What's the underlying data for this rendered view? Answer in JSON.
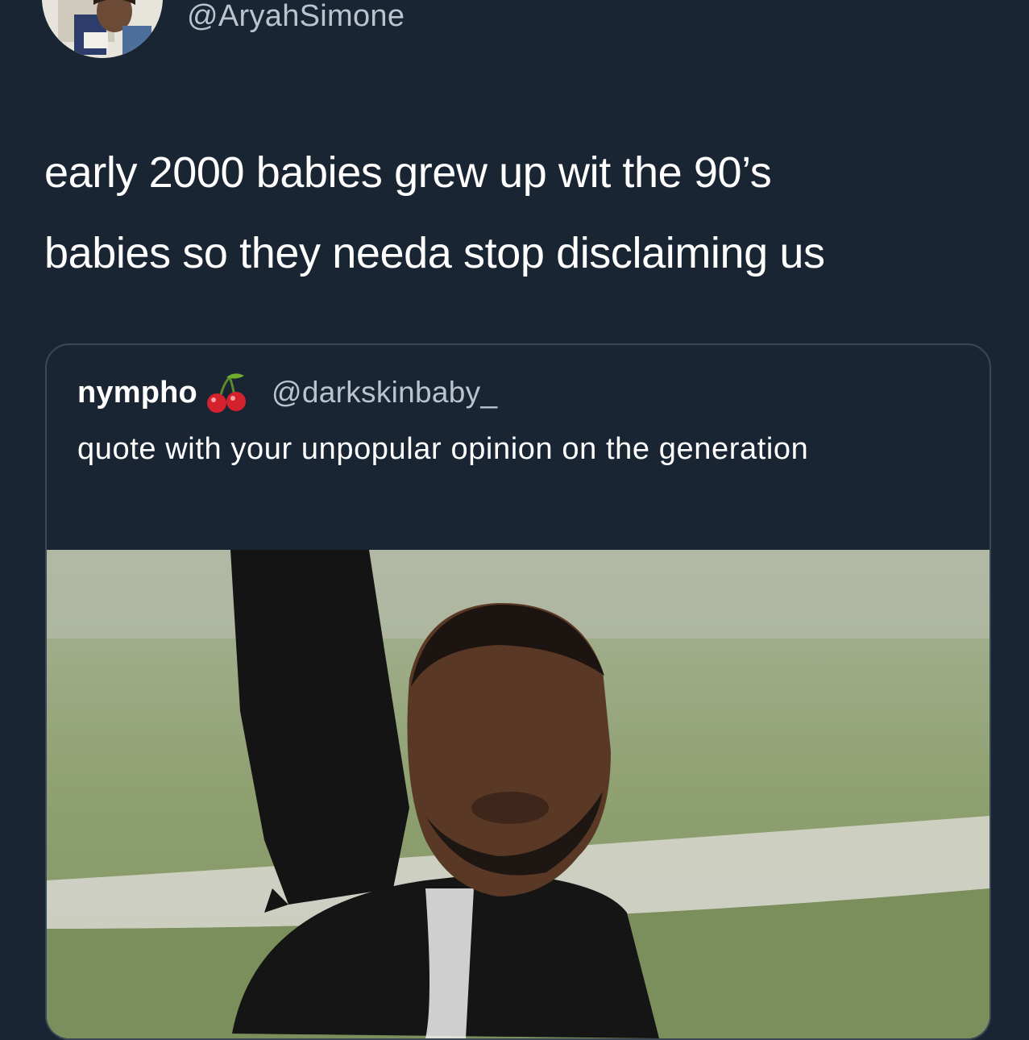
{
  "tweet": {
    "handle": "@AryahSimone",
    "text_line1": "early 2000 babies grew up wit the 90’s",
    "text_line2": "babies so they needa stop disclaiming us"
  },
  "quoted_tweet": {
    "display_name": "nympho",
    "name_emoji": "cherries-icon",
    "handle": "@darkskinbaby_",
    "text": "quote with your unpopular opinion on the generation"
  },
  "media": {
    "kind": "gif-still"
  },
  "colors": {
    "background": "#1a2533",
    "secondary_text": "#b9c4cf",
    "border": "#3a4755"
  }
}
